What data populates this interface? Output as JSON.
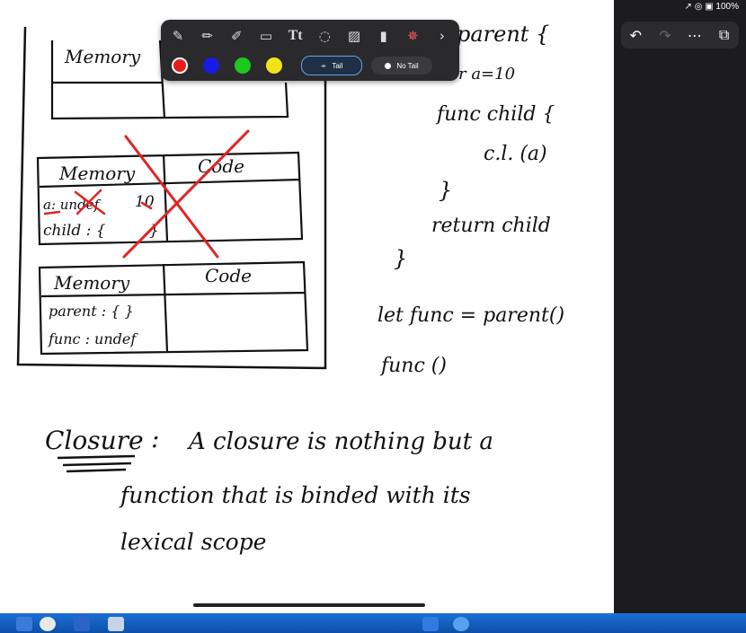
{
  "status_bar": {
    "text": "↗ ◎ ▣ 100%"
  },
  "toolbar": {
    "tools": [
      {
        "icon": "pen-icon",
        "glyph": "✎"
      },
      {
        "icon": "pencil-icon",
        "glyph": "✏"
      },
      {
        "icon": "highlighter-icon",
        "glyph": "✐"
      },
      {
        "icon": "eraser-icon",
        "glyph": "▭"
      },
      {
        "icon": "text-icon",
        "glyph": "Tt"
      },
      {
        "icon": "lasso-icon",
        "glyph": "◌"
      },
      {
        "icon": "image-icon",
        "glyph": "▨"
      },
      {
        "icon": "microphone-icon",
        "glyph": "▮"
      },
      {
        "icon": "laser-pointer-icon",
        "glyph": "✵"
      },
      {
        "icon": "chevron-right-icon",
        "glyph": "›"
      }
    ],
    "colors": [
      "#e81b1b",
      "#1a1ae6",
      "#1fc81f",
      "#f2e21a"
    ],
    "tail_label": "Tail",
    "no_tail_label": "No Tail"
  },
  "top_actions": {
    "undo": "↶",
    "redo": "↷",
    "more": "⋯",
    "pages": "⧉"
  },
  "notes": {
    "box1_memory": "Memory",
    "box2_memory": "Memory",
    "box2_code": "Code",
    "box2_line1": "a: undef",
    "box2_value": "10",
    "box2_line2": "child : {",
    "box2_brace": "}",
    "box3_memory": "Memory",
    "box3_code": "Code",
    "box3_line1": "parent : {  }",
    "box3_line2": "func : undef",
    "code_line1": "parent {",
    "code_line2": "r  a=10",
    "code_line3": "func child {",
    "code_line4": "c.l. (a)",
    "code_line5": "}",
    "code_line6": "return  child",
    "code_line7": "}",
    "code_line8": "let func = parent()",
    "code_line9": "func ()",
    "closure_word": "Closure",
    "closure_colon": ":",
    "def_line1": "A  closure  is  nothing  but  a",
    "def_line2": "function   that  is  binded  with its",
    "def_line3": "lexical  scope"
  }
}
